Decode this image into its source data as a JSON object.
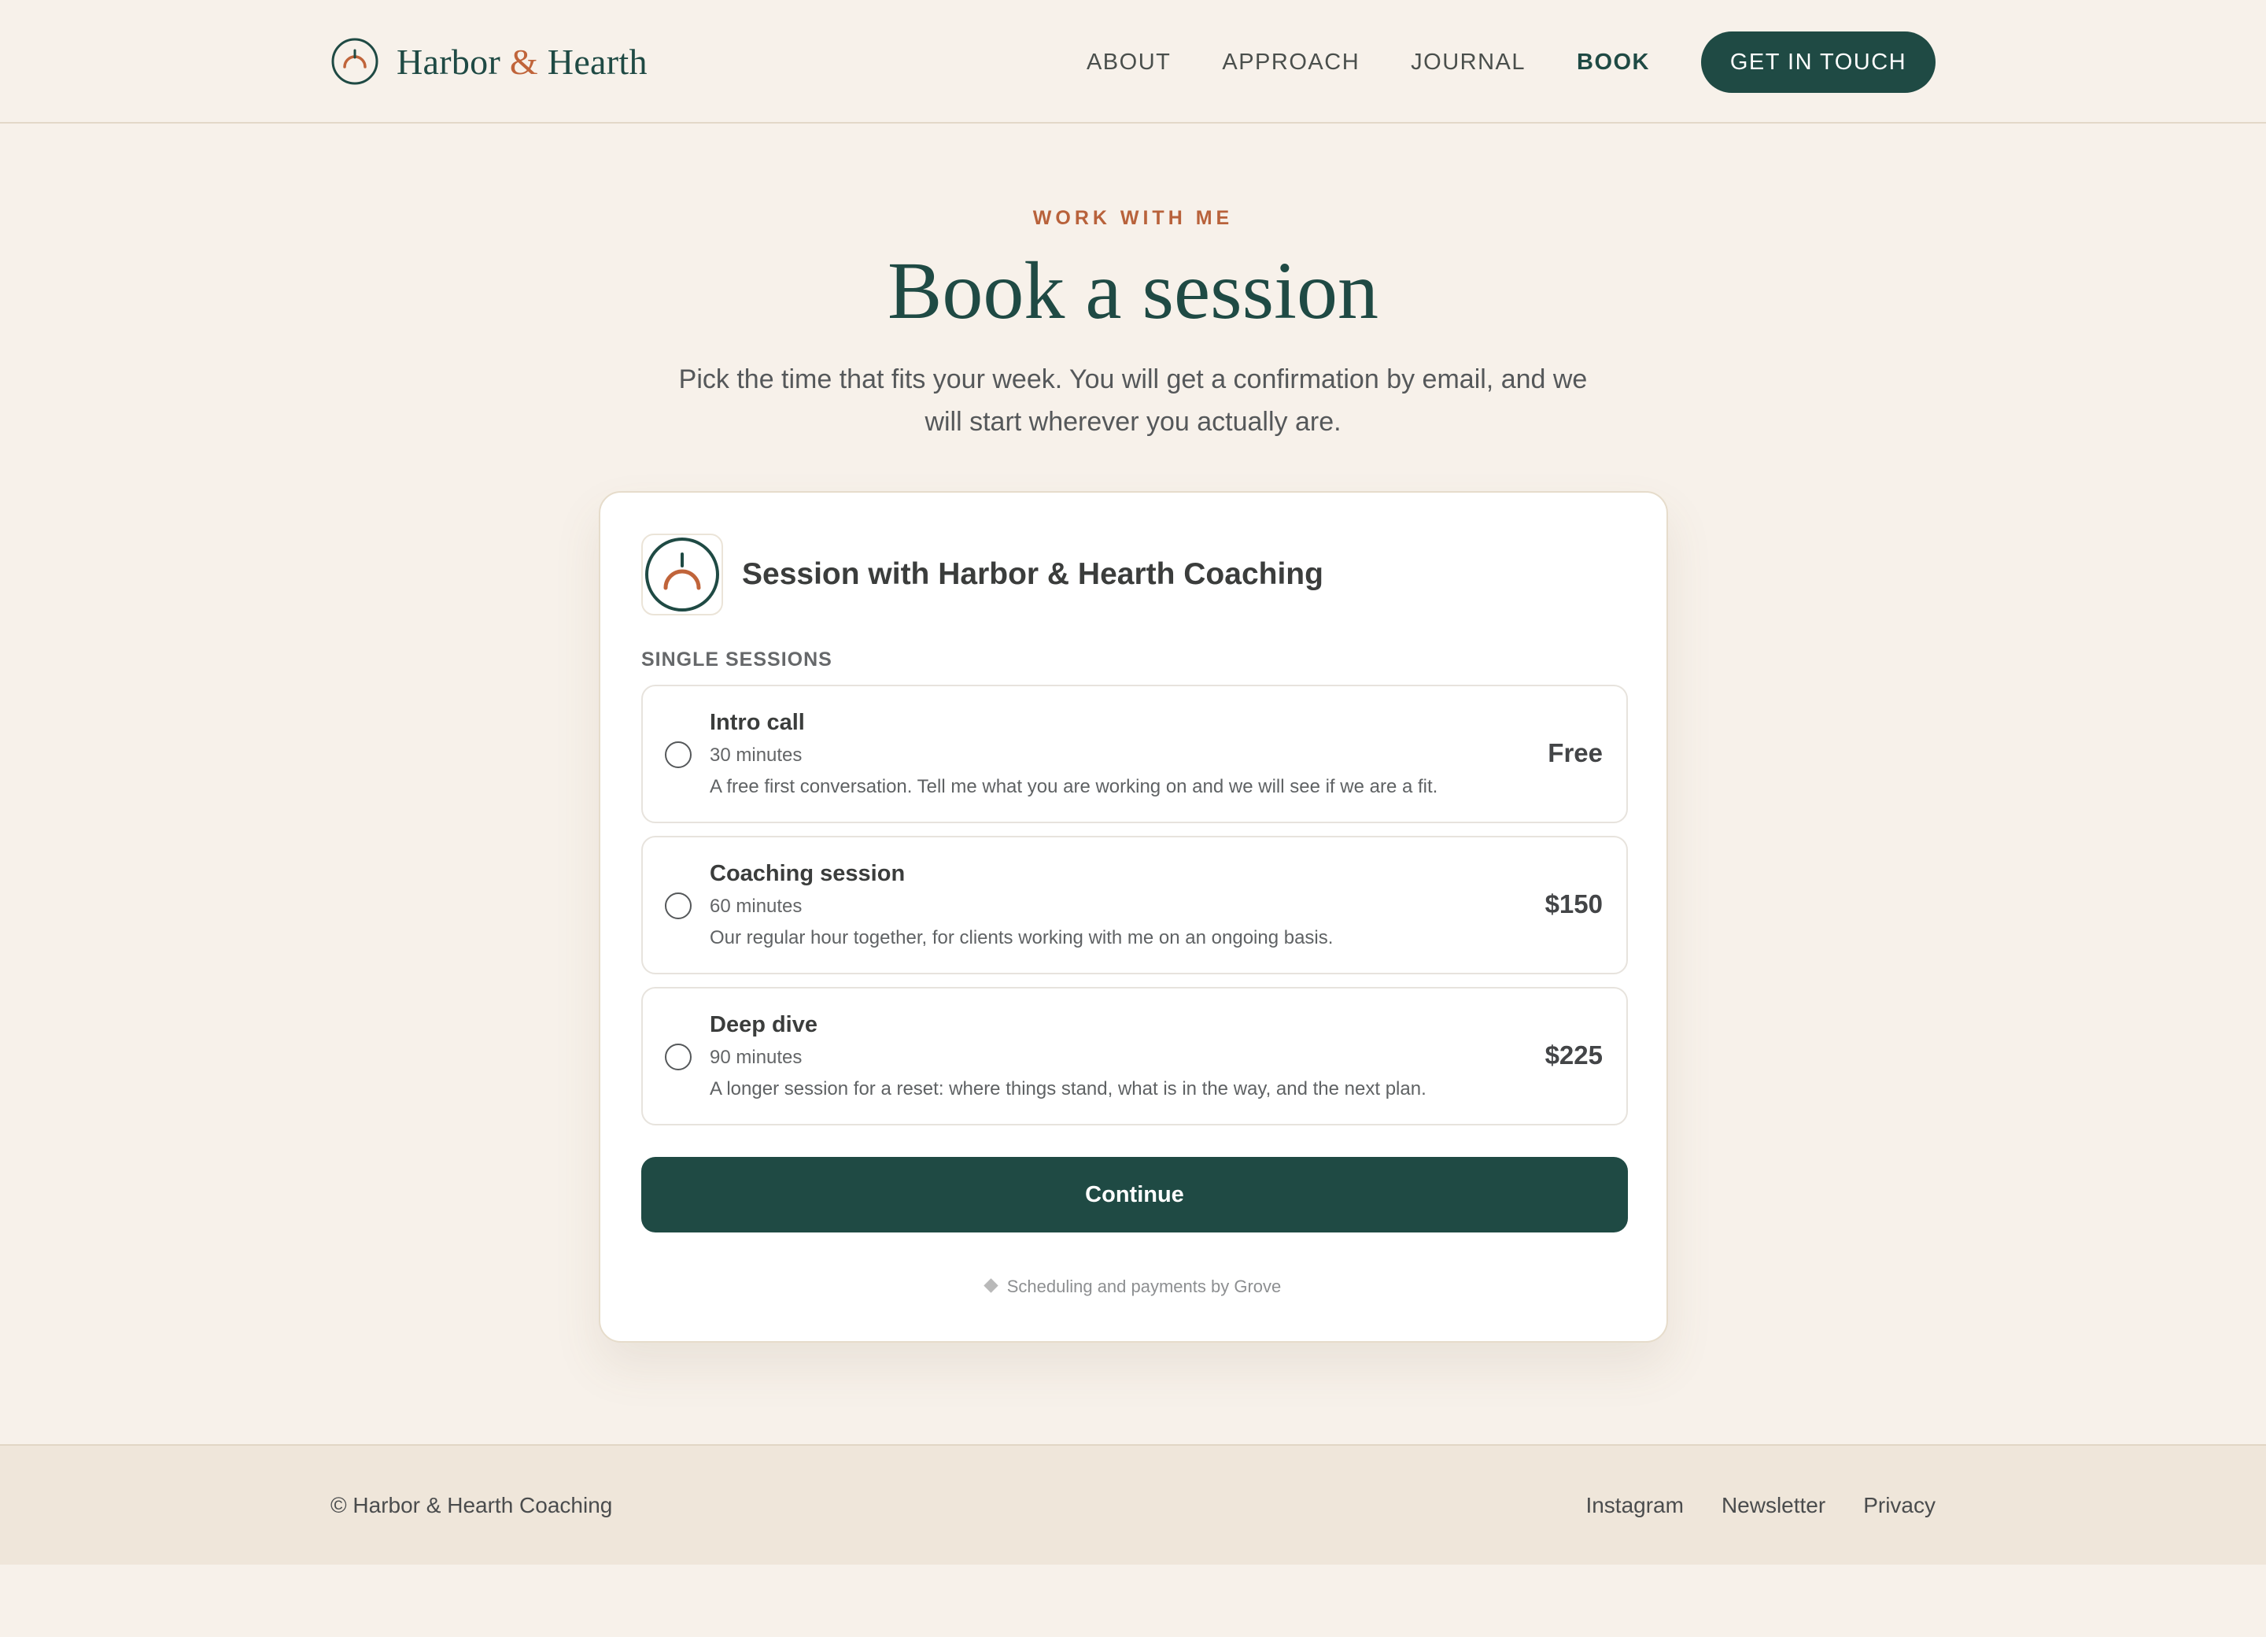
{
  "brand": {
    "name_part1": "Harbor",
    "name_amp": "&",
    "name_part2": "Hearth",
    "logo_icon": "sunrise-circle-icon"
  },
  "nav": {
    "links": [
      "ABOUT",
      "APPROACH",
      "JOURNAL",
      "BOOK"
    ],
    "active": "BOOK",
    "cta_label": "GET IN TOUCH"
  },
  "hero": {
    "eyebrow": "WORK WITH ME",
    "title": "Book a session",
    "subtitle": "Pick the time that fits your week. You will get a confirmation by email, and we will start wherever you actually are."
  },
  "booking": {
    "header_title": "Session with Harbor & Hearth Coaching",
    "section_label": "SINGLE SESSIONS",
    "options": [
      {
        "name": "Intro call",
        "duration": "30 minutes",
        "description": "A free first conversation. Tell me what you are working on and we will see if we are a fit.",
        "price": "Free",
        "selected": false
      },
      {
        "name": "Coaching session",
        "duration": "60 minutes",
        "description": "Our regular hour together, for clients working with me on an ongoing basis.",
        "price": "$150",
        "selected": false
      },
      {
        "name": "Deep dive",
        "duration": "90 minutes",
        "description": "A longer session for a reset: where things stand, what is in the way, and the next plan.",
        "price": "$225",
        "selected": false
      }
    ],
    "continue_label": "Continue",
    "powered_by": "Scheduling and payments by Grove"
  },
  "footer": {
    "copyright": "© Harbor & Hearth Coaching",
    "links": [
      "Instagram",
      "Newsletter",
      "Privacy"
    ]
  },
  "colors": {
    "page_background": "#f7f1ea",
    "primary_green": "#1f4a44",
    "accent_orange": "#c0643a",
    "footer_background": "#efe6da"
  }
}
